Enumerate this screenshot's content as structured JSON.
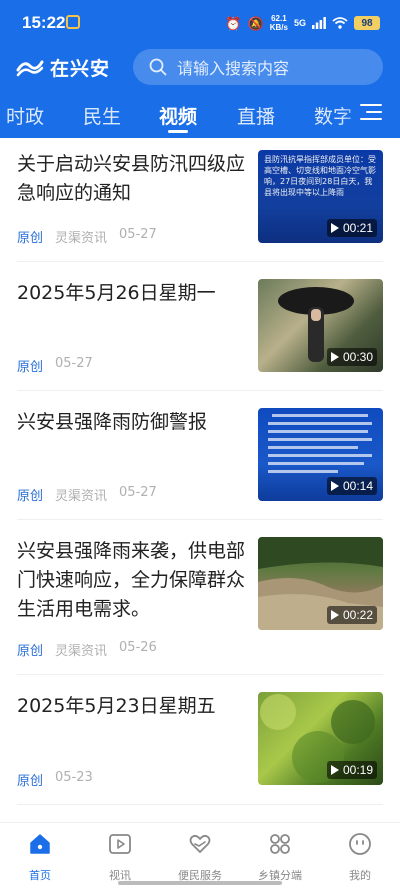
{
  "status": {
    "time": "15:22",
    "net_speed_value": "62.1",
    "net_speed_unit": "KB/s",
    "signal": "5G",
    "battery": "98"
  },
  "header": {
    "logo_text": "在兴安",
    "search_placeholder": "请输入搜索内容"
  },
  "tabs": [
    {
      "label": "时政"
    },
    {
      "label": "民生"
    },
    {
      "label": "视频",
      "active": true
    },
    {
      "label": "直播"
    },
    {
      "label": "数字"
    }
  ],
  "articles": [
    {
      "title": "关于启动兴安县防汛四级应急响应的通知",
      "tag": "原创",
      "source": "灵渠资讯",
      "date": "05-27",
      "duration": "00:21",
      "thumb_text": "县防汛抗旱指挥部成员单位：受高空槽、切变线和地面冷空气影响，27日夜间到28日白天，我县将出现中等以上降雨"
    },
    {
      "title": "2025年5月26日星期一",
      "tag": "原创",
      "source": "",
      "date": "05-27",
      "duration": "00:30"
    },
    {
      "title": "兴安县强降雨防御警报",
      "tag": "原创",
      "source": "灵渠资讯",
      "date": "05-27",
      "duration": "00:14"
    },
    {
      "title": "兴安县强降雨来袭，供电部门快速响应，全力保障群众生活用电需求。",
      "tag": "原创",
      "source": "灵渠资讯",
      "date": "05-26",
      "duration": "00:22"
    },
    {
      "title": "2025年5月23日星期五",
      "tag": "原创",
      "source": "",
      "date": "05-23",
      "duration": "00:19"
    }
  ],
  "bottom_nav": [
    {
      "label": "首页",
      "icon": "home-icon",
      "active": true
    },
    {
      "label": "视讯",
      "icon": "video-icon"
    },
    {
      "label": "便民服务",
      "icon": "heart-hand-icon"
    },
    {
      "label": "乡镇分端",
      "icon": "grid-icon"
    },
    {
      "label": "我的",
      "icon": "profile-icon"
    }
  ],
  "colors": {
    "brand_blue": "#1a6ee8",
    "original_tag": "#2a6fd8",
    "meta_gray": "#b0b0b0",
    "battery": "#f2cf62"
  }
}
